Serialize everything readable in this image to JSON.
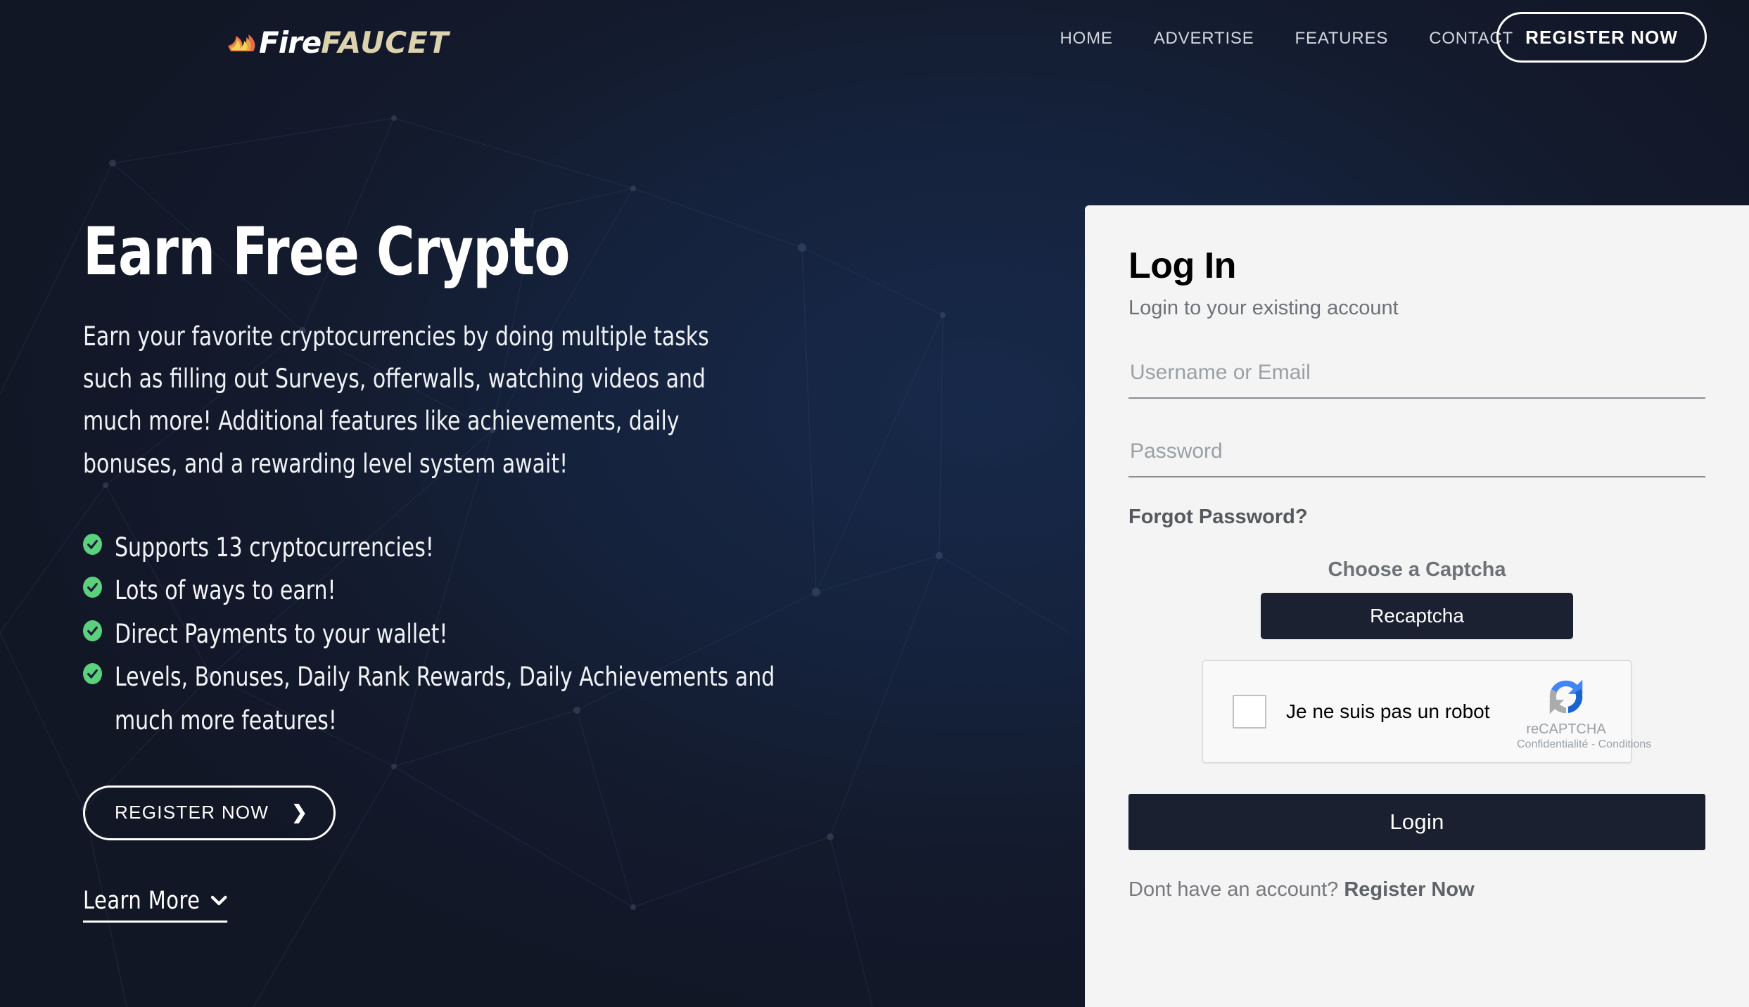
{
  "brand": {
    "logo_fire": "Fire",
    "logo_faucet": "FAUCET",
    "flame_icon": "flame-icon"
  },
  "header": {
    "nav": [
      {
        "label": "HOME",
        "name": "nav-home"
      },
      {
        "label": "ADVERTISE",
        "name": "nav-advertise"
      },
      {
        "label": "FEATURES",
        "name": "nav-features"
      },
      {
        "label": "CONTACT",
        "name": "nav-contact"
      }
    ],
    "register_label": "REGISTER NOW"
  },
  "hero": {
    "title": "Earn Free Crypto",
    "description": "Earn your favorite cryptocurrencies by doing multiple tasks such as filling out Surveys, offerwalls, watching videos and much more! Additional features like achievements, daily bonuses, and a rewarding level system await!",
    "features": [
      "Supports 13 cryptocurrencies!",
      "Lots of ways to earn!",
      "Direct Payments to your wallet!",
      "Levels, Bonuses, Daily Rank Rewards, Daily Achievements and much more features!"
    ],
    "register_label": "REGISTER NOW",
    "register_chevron": "❯",
    "learn_more_label": "Learn More",
    "learn_more_chevron": "⌄"
  },
  "login": {
    "title": "Log In",
    "subtitle": "Login to your existing account",
    "username_placeholder": "Username or Email",
    "username_value": "",
    "password_placeholder": "Password",
    "password_value": "",
    "forgot_label": "Forgot Password?",
    "captcha_choose_label": "Choose a Captcha",
    "captcha_option_label": "Recaptcha",
    "recaptcha": {
      "checkbox_label": "Je ne suis pas un robot",
      "brand_name": "reCAPTCHA",
      "terms": "Confidentialité - Conditions"
    },
    "login_button": "Login",
    "signup_prompt": "Dont have an account? ",
    "signup_link": "Register Now"
  },
  "colors": {
    "background": "#151b2b",
    "background_mid": "#17294a",
    "panel": "#f4f4f4",
    "dark_button": "#1a2030",
    "check_green": "#5bd17e",
    "logo_gold": "#ddd2ae",
    "text_light": "#eef1f5",
    "nav_text": "#d2d7df"
  }
}
